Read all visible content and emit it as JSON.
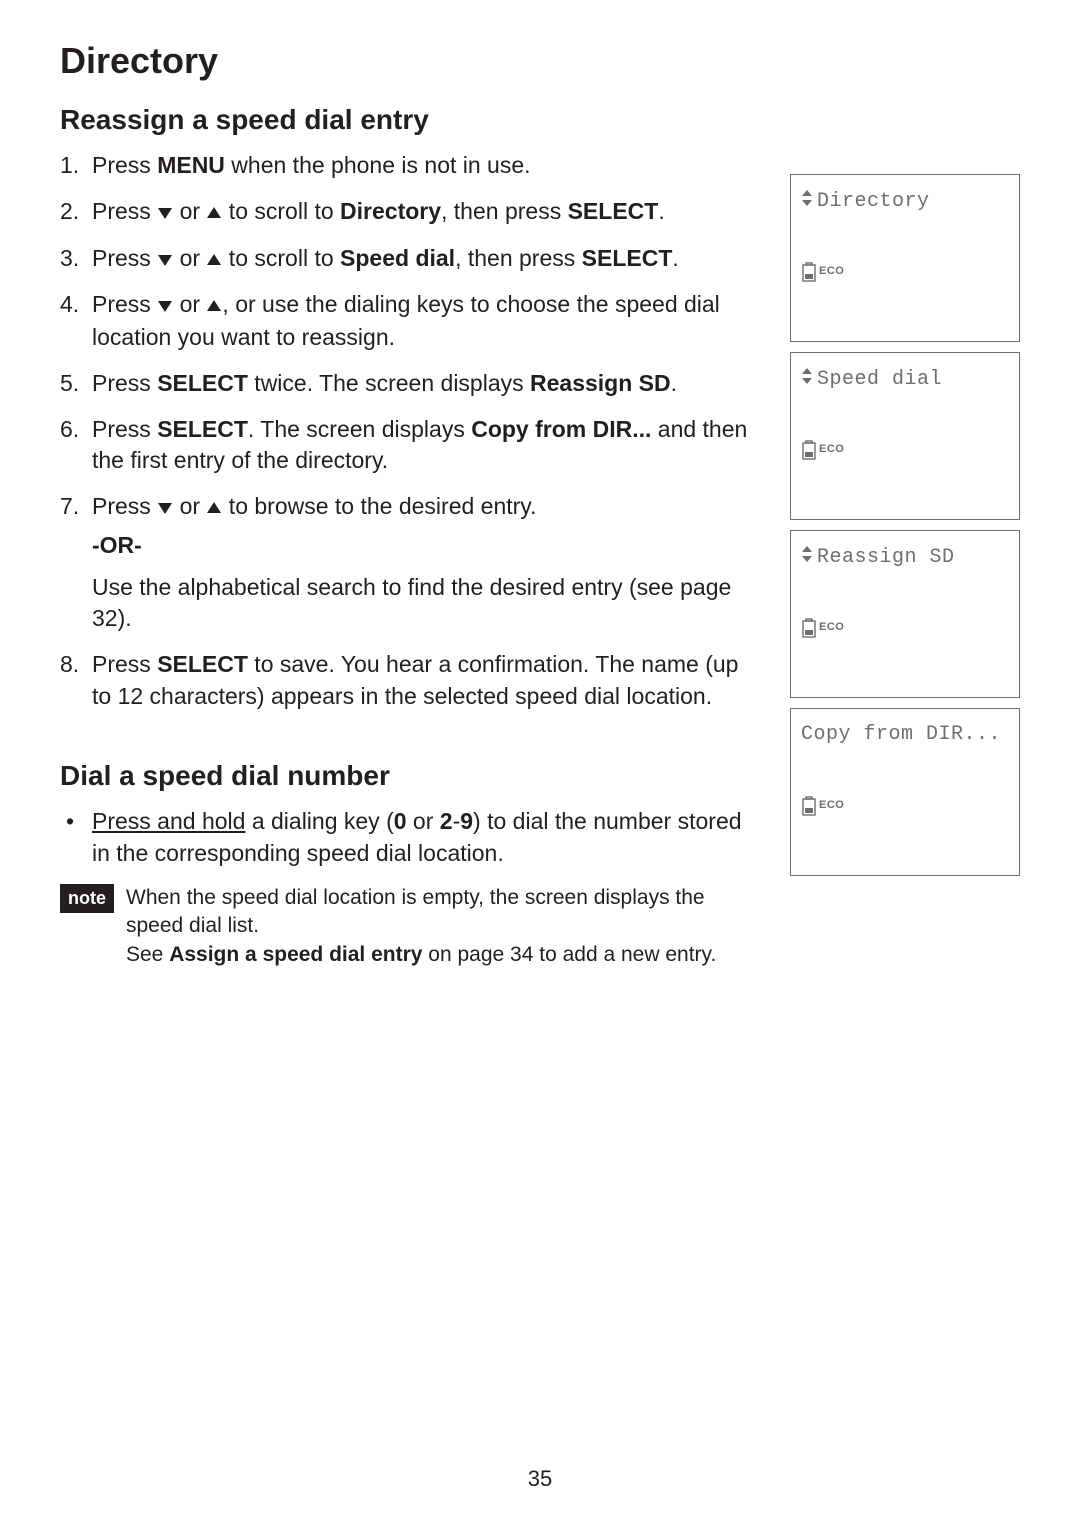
{
  "title": "Directory",
  "section1": {
    "heading": "Reassign a speed dial entry",
    "steps": [
      {
        "n": "1.",
        "pre": "Press ",
        "b1": "MENU",
        "post": " when the phone is not in use."
      },
      {
        "n": "2.",
        "pre": "Press ",
        "mid": " or ",
        "post1": " to scroll to ",
        "b1": "Directory",
        "post2": ", then press ",
        "b2": "SELECT",
        "post3": "."
      },
      {
        "n": "3.",
        "pre": "Press ",
        "mid": " or ",
        "post1": " to scroll to ",
        "b1": "Speed dial",
        "post2": ", then press ",
        "b2": "SELECT",
        "post3": "."
      },
      {
        "n": "4.",
        "pre": "Press ",
        "mid": " or ",
        "post": ", or use the dialing keys to choose the speed dial location you want to reassign."
      },
      {
        "n": "5.",
        "pre": "Press ",
        "b1": "SELECT",
        "mid": " twice. The screen displays ",
        "b2": "Reassign SD",
        "post": "."
      },
      {
        "n": "6.",
        "pre": "Press ",
        "b1": "SELECT",
        "mid": ". The screen displays ",
        "b2": "Copy from DIR...",
        "post": " and then the first entry of the directory."
      },
      {
        "n": "7.",
        "pre": "Press ",
        "mid": " or ",
        "post": " to browse to the desired entry."
      },
      {
        "or": "-OR-",
        "alt": "Use the alphabetical search to find the desired entry (see page 32)."
      },
      {
        "n": "8.",
        "pre": "Press ",
        "b1": "SELECT",
        "post": " to save. You hear a confirmation. The name (up to 12 characters) appears in the selected speed dial location."
      }
    ]
  },
  "section2": {
    "heading": "Dial a speed dial number",
    "bullet": {
      "u": "Press and hold",
      "mid": " a dialing key (",
      "b1": "0",
      "mid2": " or ",
      "b2": "2",
      "dash": "-",
      "b3": "9",
      "post": ") to dial the number stored in the corresponding speed dial location."
    }
  },
  "note": {
    "label": "note",
    "line1": "When the speed dial location is empty, the screen displays the speed dial list.",
    "line2a": "See ",
    "line2b": "Assign a speed dial entry",
    "line2c": " on page 34 to add a new entry."
  },
  "screens": [
    {
      "text": "Directory",
      "icon": "updown"
    },
    {
      "text": "Speed dial",
      "icon": "updown"
    },
    {
      "text": "Reassign SD",
      "icon": "updown"
    },
    {
      "text": "Copy from DIR...",
      "icon": "none"
    }
  ],
  "eco": "ECO",
  "pageNumber": "35"
}
